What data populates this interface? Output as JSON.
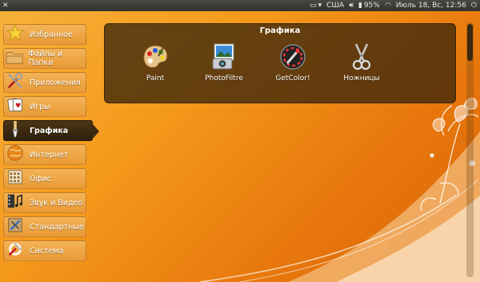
{
  "top_panel": {
    "keyboard_layout": "США",
    "battery": "95%",
    "datetime": "Июль 18, Вс, 12:56"
  },
  "sidebar": {
    "items": [
      {
        "label": "Избранное",
        "icon": "star-icon"
      },
      {
        "label": "Файлы и Папки",
        "icon": "folder-icon"
      },
      {
        "label": "Приложения",
        "icon": "tools-icon"
      },
      {
        "label": "Игры",
        "icon": "cards-icon"
      },
      {
        "label": "Графика",
        "icon": "brush-icon",
        "active": true
      },
      {
        "label": "Интернет",
        "icon": "globe-icon"
      },
      {
        "label": "Офис",
        "icon": "calculator-icon"
      },
      {
        "label": "Звук и Видео",
        "icon": "film-music-icon"
      },
      {
        "label": "Стандартные",
        "icon": "accessories-icon"
      },
      {
        "label": "Система",
        "icon": "system-tools-icon"
      }
    ]
  },
  "panel": {
    "title": "Графика",
    "apps": [
      {
        "label": "Paint",
        "icon": "palette-icon"
      },
      {
        "label": "PhotoFiltre",
        "icon": "photo-camera-icon"
      },
      {
        "label": "GetColor!",
        "icon": "color-picker-icon"
      },
      {
        "label": "Ножницы",
        "icon": "scissors-icon"
      }
    ]
  },
  "colors": {
    "background": "#f59a1c",
    "active_item": "#3a2810",
    "panel": "#3c260c"
  }
}
